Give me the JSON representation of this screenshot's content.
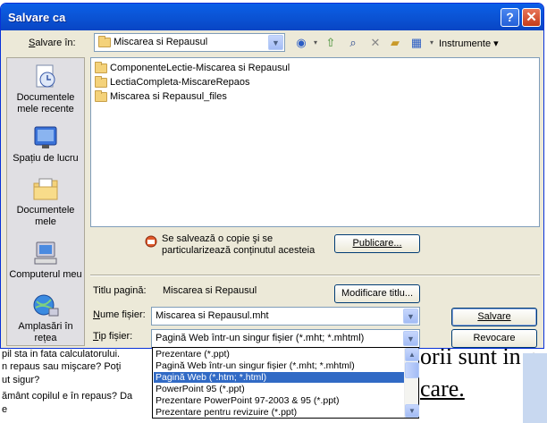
{
  "background": {
    "lines": [
      "pil sta in fata calculatorului.",
      "n repaus sau mişcare? Poţi",
      "ut sigur?",
      "ământ copilul e în repaus? Da",
      "e"
    ],
    "big_text_1": "orii sunt in r",
    "big_text_2": "care."
  },
  "dialog": {
    "title": "Salvare ca",
    "help_button": "?",
    "close_button": "✕",
    "save_in_label_prefix": "S",
    "save_in_label_rest": "alvare în:",
    "save_in_value": "Miscarea si Repausul",
    "tools_label": "Instrumente",
    "places": [
      {
        "line1": "Documentele",
        "line2": "mele recente"
      },
      {
        "line1": "Spațiu de lucru",
        "line2": ""
      },
      {
        "line1": "Documentele",
        "line2": "mele"
      },
      {
        "line1": "Computerul meu",
        "line2": ""
      },
      {
        "line1": "Amplasări în",
        "line2": "rețea"
      }
    ],
    "files": [
      "ComponenteLectie-Miscarea si Repausul",
      "LectiaCompleta-MiscareRepaos",
      "Miscarea si Repausul_files"
    ],
    "publish_note_line1": "Se salvează o copie şi se",
    "publish_note_line2": "particularizează conținutul acesteia",
    "publish_button": "Publicare...",
    "page_title_label": "Titlu pagină:",
    "page_title_value": "Miscarea si Repausul",
    "change_title_button": "Modificare titlu...",
    "filename_label_prefix": "N",
    "filename_label_rest": "ume fișier:",
    "filename_value": "Miscarea si Repausul.mht",
    "filetype_label_prefix": "T",
    "filetype_label_rest": "ip fișier:",
    "filetype_value": "Pagină Web într-un singur fișier (*.mht; *.mhtml)",
    "save_button": "Salvare",
    "cancel_button": "Revocare"
  },
  "dropdown": {
    "options": [
      "Prezentare (*.ppt)",
      "Pagină Web într-un singur fișier (*.mht; *.mhtml)",
      "Pagină Web (*.htm; *.html)",
      "PowerPoint 95 (*.ppt)",
      "Prezentare PowerPoint 97-2003 & 95 (*.ppt)",
      "Prezentare pentru revizuire (*.ppt)"
    ],
    "selected_index": 2
  }
}
